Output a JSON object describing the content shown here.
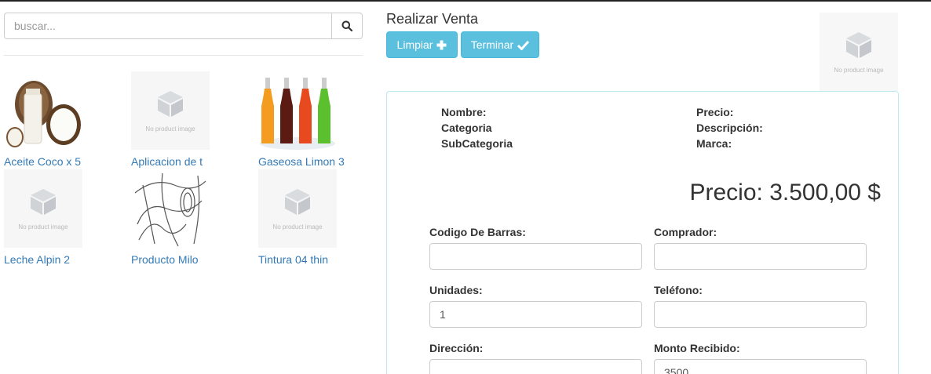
{
  "search": {
    "placeholder": "buscar...",
    "icon": "search-icon"
  },
  "products": [
    {
      "name": "Aceite Coco x 5",
      "image": "coconut"
    },
    {
      "name": "Aplicacion de t",
      "image": "no-image"
    },
    {
      "name": "Gaseosa Limon 3",
      "image": "bottles"
    },
    {
      "name": "Leche Alpin 2",
      "image": "no-image"
    },
    {
      "name": "Producto Milo",
      "image": "sketch"
    },
    {
      "name": "Tintura 04 thin",
      "image": "no-image"
    }
  ],
  "no_image_label": "No product image",
  "sale": {
    "title": "Realizar Venta",
    "btn_limpiar": "Limpiar",
    "btn_terminar": "Terminar"
  },
  "details": {
    "nombre": "Nombre:",
    "categoria": "Categoria",
    "subcategoria": "SubCategoria",
    "precio": "Precio:",
    "descripcion": "Descripción:",
    "marca": "Marca:"
  },
  "price_display": "Precio: 3.500,00 $",
  "form": {
    "codigo_label": "Codigo De Barras:",
    "codigo_value": "",
    "comprador_label": "Comprador:",
    "comprador_value": "",
    "unidades_label": "Unidades:",
    "unidades_value": "1",
    "telefono_label": "Teléfono:",
    "telefono_value": "",
    "direccion_label": "Dirección:",
    "direccion_value": "",
    "monto_label": "Monto Recibido:",
    "monto_value": "3500"
  },
  "colors": {
    "accent": "#5bc0de",
    "link": "#337ab7",
    "panel_border": "#bce8f1"
  }
}
